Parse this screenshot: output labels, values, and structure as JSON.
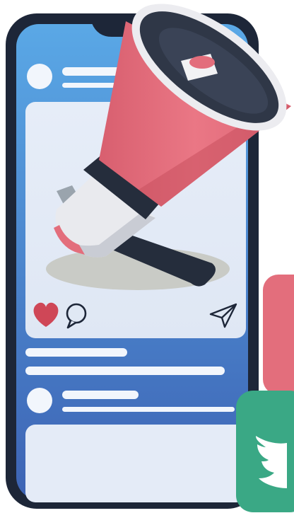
{
  "colors": {
    "phone_frame": "#1d2638",
    "screen_top": "#5aa8e6",
    "screen_bottom": "#3d63b4",
    "card": "#e4ebf7",
    "placeholder": "#f2f6fc",
    "shadow": "#c9cbc6",
    "megaphone_red": "#e36e7c",
    "megaphone_dark": "#252d3c",
    "megaphone_white": "#e9eaee",
    "heart": "#cf4757",
    "twitter_green": "#3aa885"
  },
  "icons": [
    "megaphone-icon",
    "heart-icon",
    "comment-icon",
    "send-icon",
    "twitter-bird-icon",
    "avatar-icon"
  ],
  "post": {
    "liked": true
  }
}
